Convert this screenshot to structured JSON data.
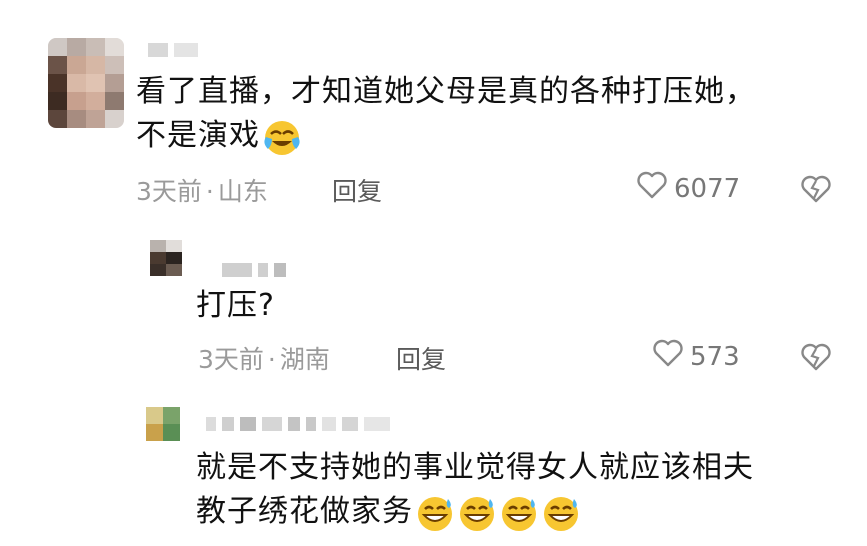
{
  "comments": [
    {
      "text_line1": "看了直播，才知道她父母是真的各种打压她，",
      "text_line2": "不是演戏",
      "emoji": "laughing-crying-emoji",
      "time": "3天前",
      "location": "山东",
      "separator": "·",
      "reply_label": "回复",
      "likes": "6077"
    },
    {
      "text": "打压?",
      "time": "3天前",
      "location": "湖南",
      "separator": "·",
      "reply_label": "回复",
      "likes": "573"
    },
    {
      "text_line1": "就是不支持她的事业觉得女人就应该相夫",
      "text_line2": "教子绣花做家务",
      "emoji": "grinning-sweat-emoji",
      "emoji_count": 4
    }
  ],
  "icons": {
    "like": "heart-outline-icon",
    "dislike": "broken-heart-icon"
  },
  "colors": {
    "text": "#111111",
    "meta": "#9a9a9a",
    "icon": "#777777",
    "emoji_face": "#f7c631"
  }
}
